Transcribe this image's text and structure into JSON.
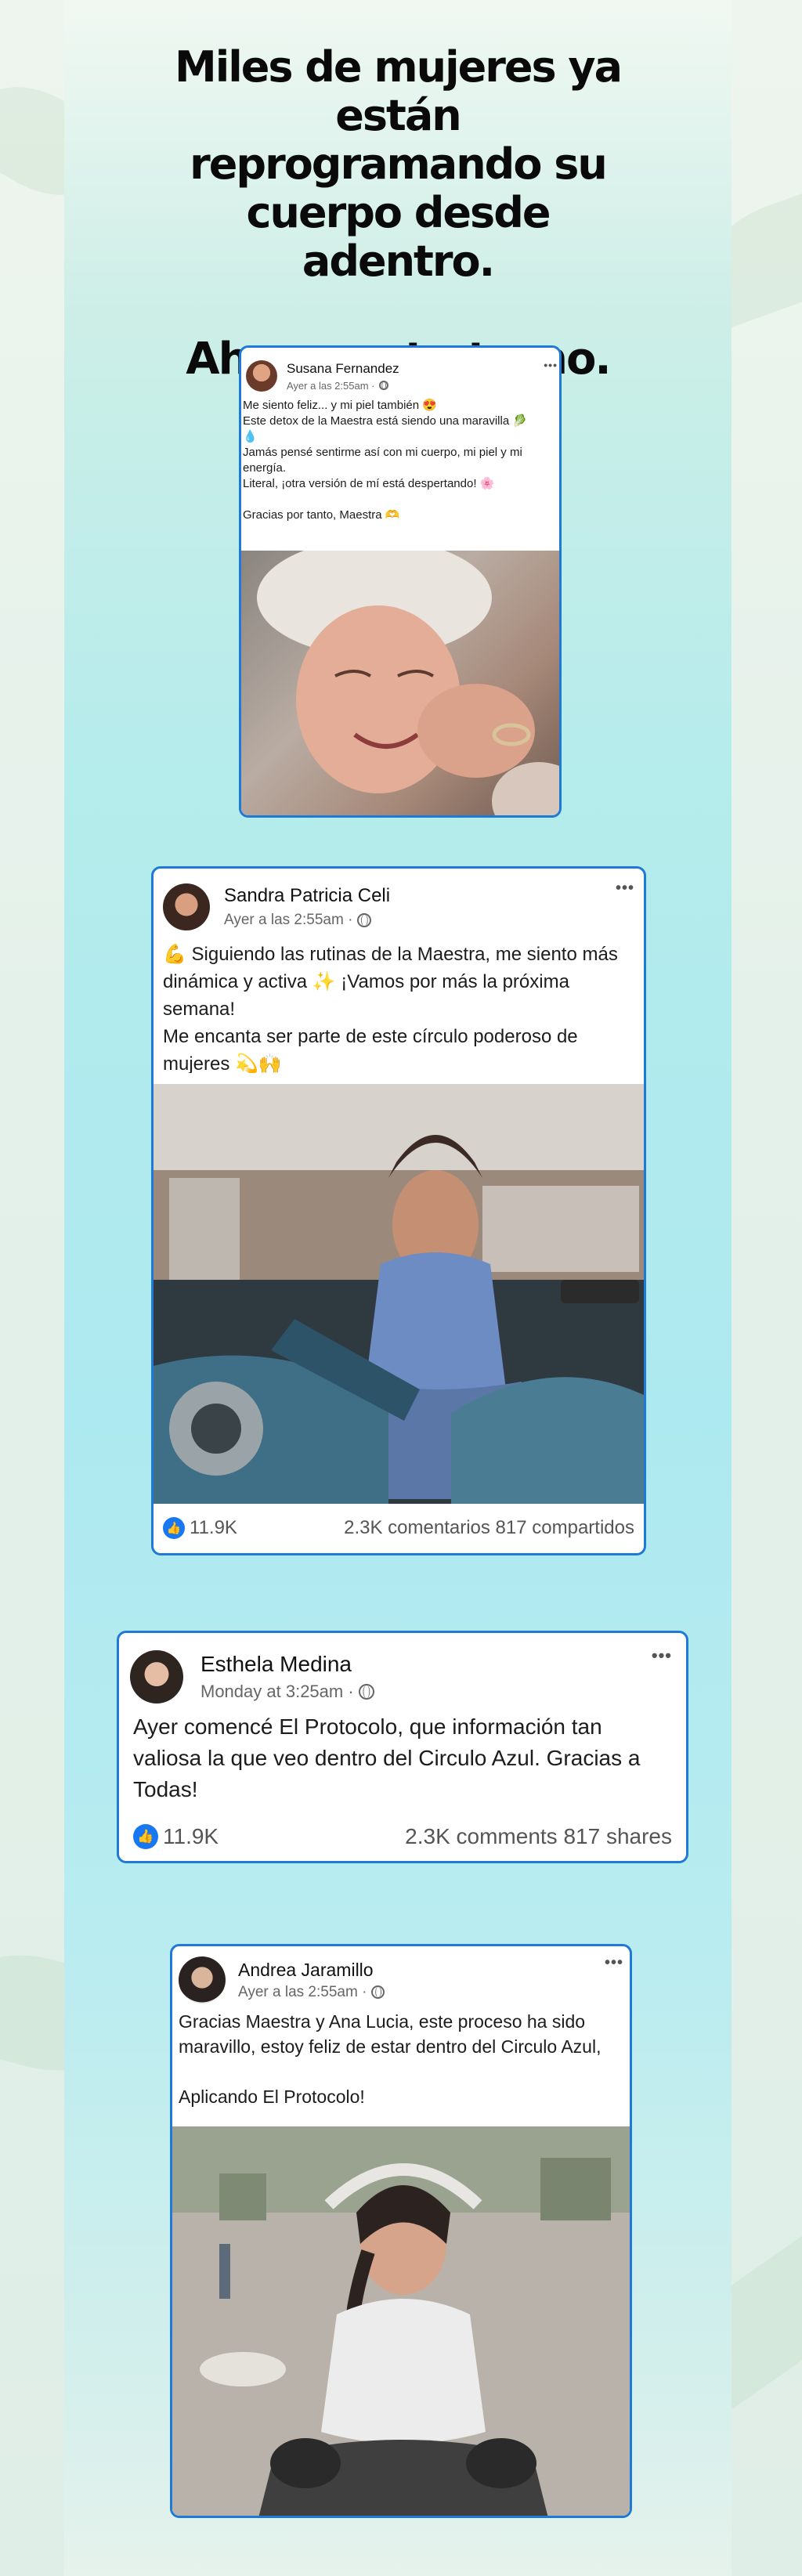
{
  "headline": {
    "line1": "Miles de mujeres ya están reprogramando su cuerpo desde adentro.",
    "line2": "Ahora es tu turno."
  },
  "posts": [
    {
      "name": "Susana Fernandez",
      "time": "Ayer a las 2:55am ·",
      "text": "Me siento feliz... y mi piel también 😍\nEste detox de la Maestra está siendo una maravilla 🥬\n💧\nJamás pensé sentirme así con mi cuerpo, mi piel y mi energía.\nLiteral, ¡otra versión de mí está despertando! 🌸\n\nGracias por tanto, Maestra 🫶"
    },
    {
      "name": "Sandra Patricia Celi",
      "time": "Ayer a las 2:55am ·",
      "text": "💪 Siguiendo las rutinas de la Maestra, me siento más dinámica y activa ✨ ¡Vamos por más la próxima semana!\nMe encanta ser parte de este círculo poderoso de mujeres 💫🙌",
      "likes": "11.9K",
      "stats": "2.3K comentarios 817 compartidos"
    },
    {
      "name": "Esthela Medina",
      "time": "Monday at 3:25am ·",
      "text": "Ayer comencé El Protocolo, que información tan valiosa la que veo dentro del Circulo Azul. Gracias a Todas!",
      "likes": "11.9K",
      "stats": "2.3K comments 817 shares"
    },
    {
      "name": "Andrea Jaramillo",
      "time": "Ayer a las 2:55am ·",
      "text": "Gracias Maestra y Ana Lucia, este proceso ha sido maravillo, estoy feliz de estar dentro del Circulo Azul,\n\nAplicando El Protocolo!"
    }
  ],
  "more_label": "•••",
  "like_glyph": "👍",
  "colors": {
    "border": "#1e7ad6",
    "like": "#1877f2"
  }
}
